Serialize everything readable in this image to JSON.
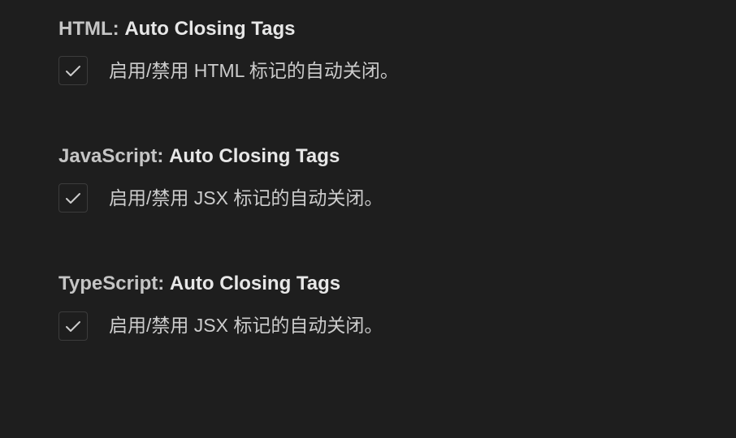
{
  "settings": [
    {
      "category": "HTML: ",
      "name": "Auto Closing Tags",
      "description": "启用/禁用 HTML 标记的自动关闭。",
      "checked": true
    },
    {
      "category": "JavaScript: ",
      "name": "Auto Closing Tags",
      "description": "启用/禁用 JSX 标记的自动关闭。",
      "checked": true
    },
    {
      "category": "TypeScript: ",
      "name": "Auto Closing Tags",
      "description": "启用/禁用 JSX 标记的自动关闭。",
      "checked": true
    }
  ]
}
